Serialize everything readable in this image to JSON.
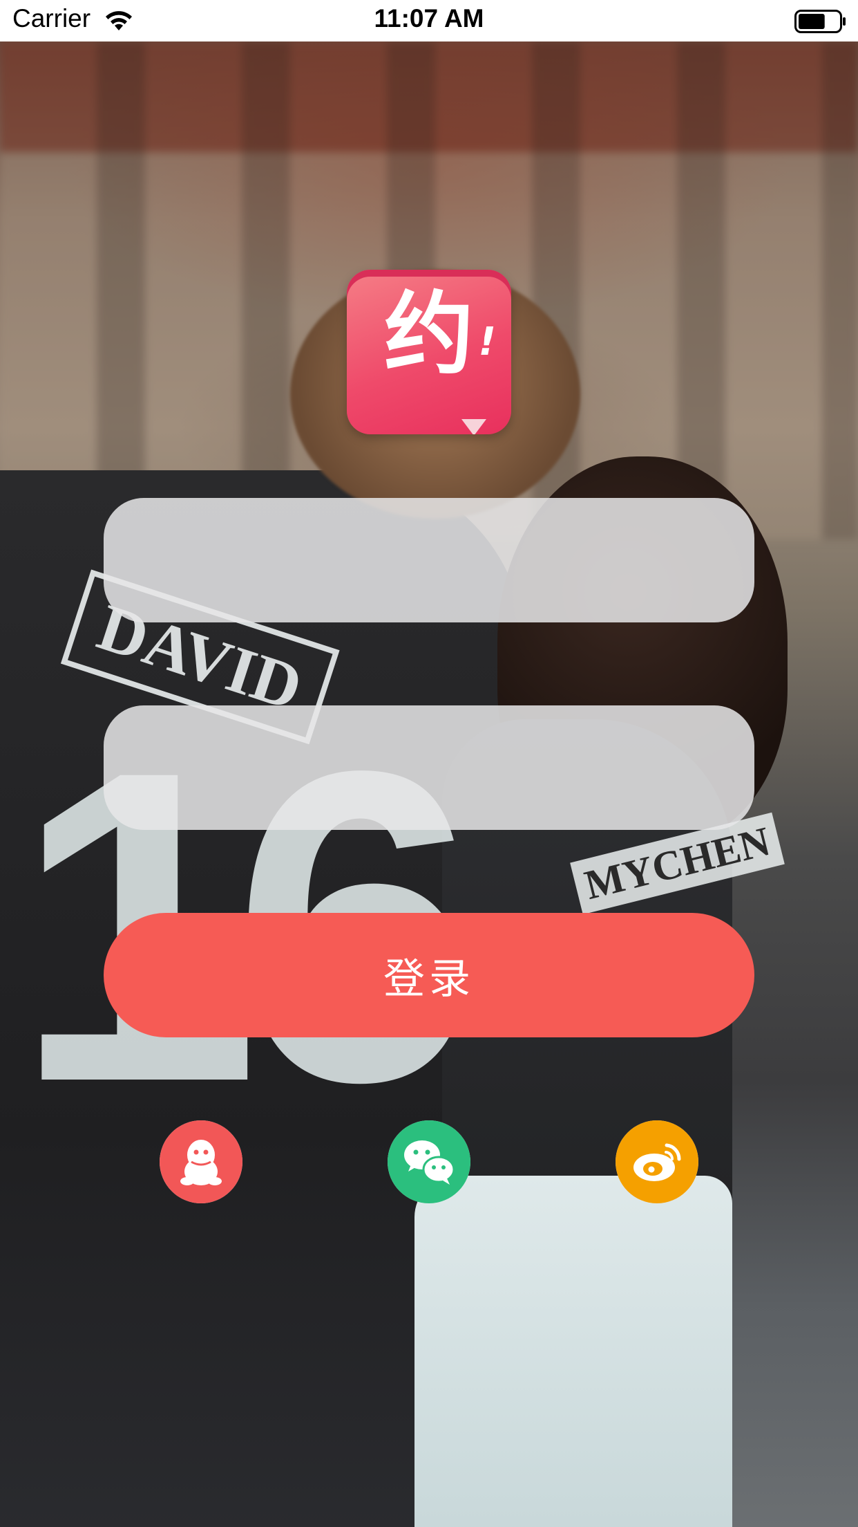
{
  "status_bar": {
    "carrier": "Carrier",
    "time": "11:07 AM",
    "battery_level": 0.65
  },
  "logo": {
    "glyph": "约",
    "mark": "!"
  },
  "form": {
    "username_placeholder": "",
    "password_placeholder": "",
    "login_label": "登录"
  },
  "background": {
    "shirt_number": "16",
    "shirt_name": "DAVID",
    "shirt_name_2": "MYCHEN"
  },
  "social": [
    {
      "name": "qq",
      "color": "#f25757",
      "icon": "qq-penguin-icon"
    },
    {
      "name": "wechat",
      "color": "#2bbf7e",
      "icon": "wechat-icon"
    },
    {
      "name": "weibo",
      "color": "#f5a000",
      "icon": "weibo-icon"
    }
  ],
  "colors": {
    "login_button": "#f65b55",
    "logo_gradient_top": "#f57e86",
    "logo_gradient_bottom": "#e8305d"
  }
}
